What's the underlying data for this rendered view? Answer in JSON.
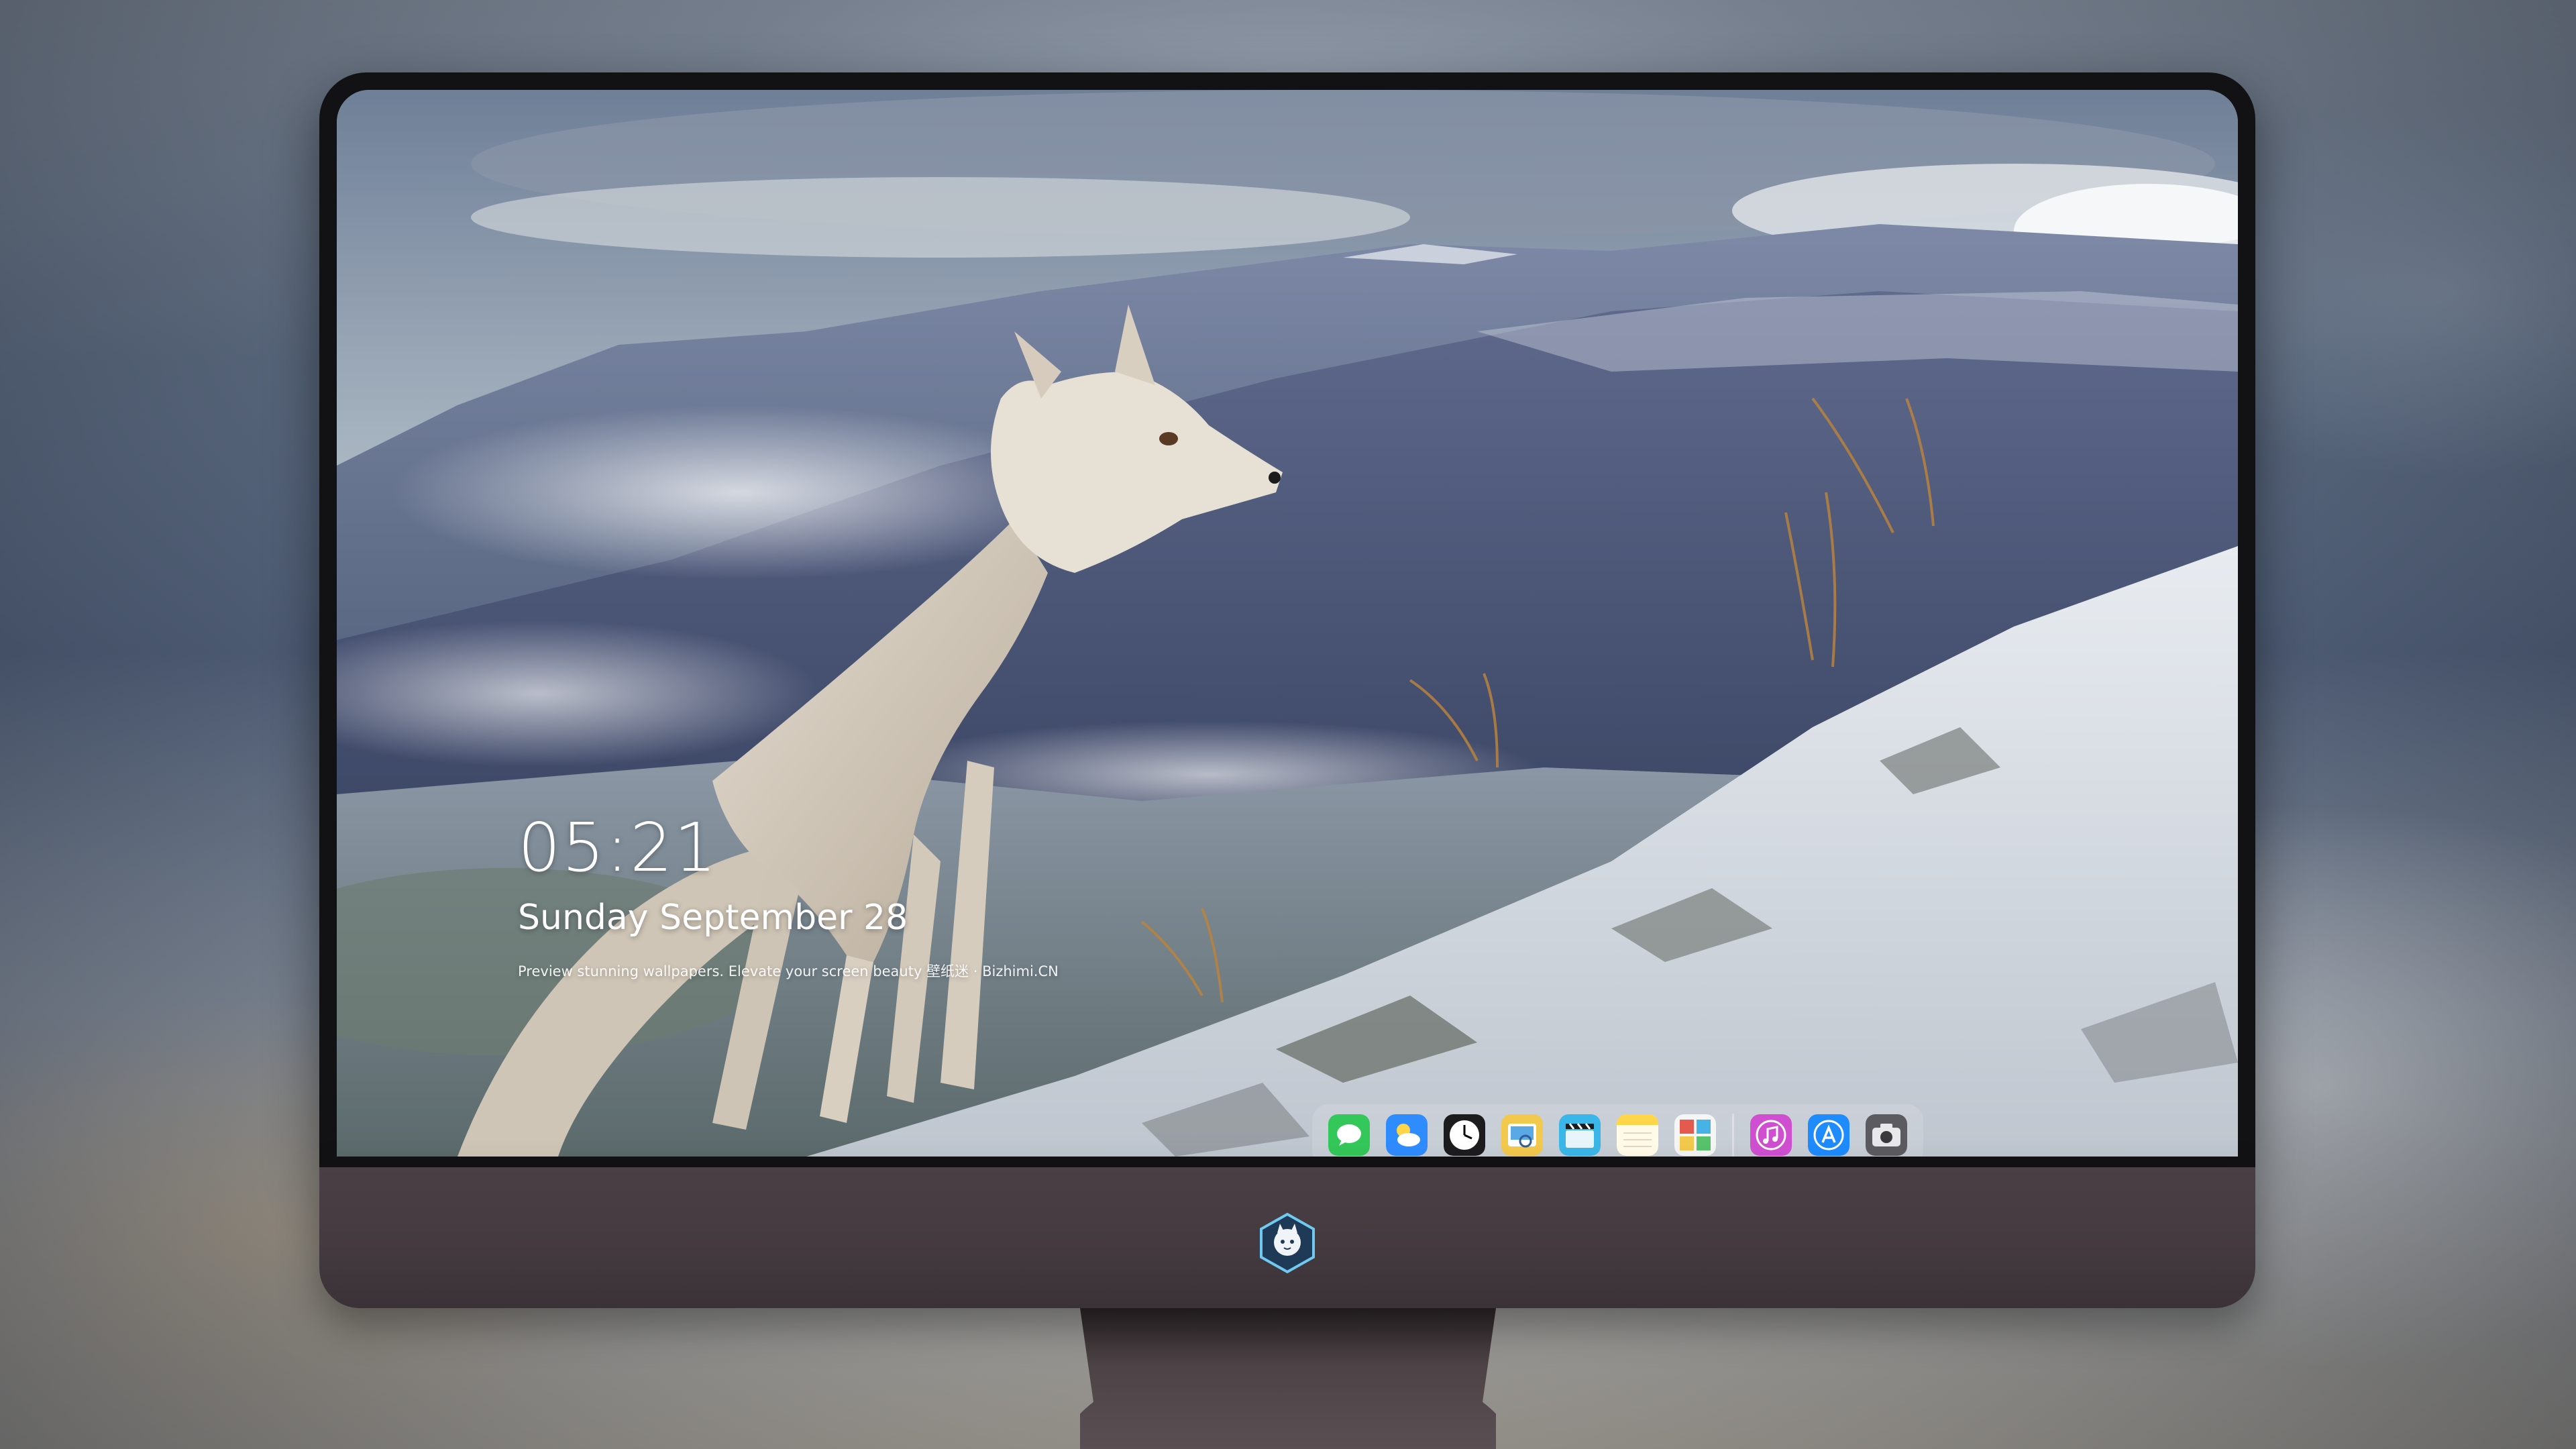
{
  "clock": {
    "time": "05:21",
    "date": "Sunday September  28",
    "note": "Preview stunning wallpapers. Elevate your screen beauty  壁纸迷 · Bizhimi.CN"
  },
  "dock": {
    "apps": [
      {
        "name": "messages-icon",
        "color": "#34c759"
      },
      {
        "name": "weather-icon",
        "color": "#2f8cff"
      },
      {
        "name": "clock-icon",
        "color": "#1c1c1e"
      },
      {
        "name": "preview-icon",
        "color": "#f2c94c"
      },
      {
        "name": "claquette-icon",
        "color": "#3ab7e8"
      },
      {
        "name": "notes-icon",
        "color": "#ffd54a"
      },
      {
        "name": "photo-booth-icon",
        "color": "#e55a4e"
      },
      {
        "name": "itunes-icon",
        "color": "#d04fd1"
      },
      {
        "name": "app-store-icon",
        "color": "#1e8bff"
      },
      {
        "name": "camera-icon",
        "color": "#5b5b60"
      }
    ]
  },
  "colors": {
    "chin": "#433a3f",
    "bezel": "#121214",
    "text": "#ffffff"
  }
}
